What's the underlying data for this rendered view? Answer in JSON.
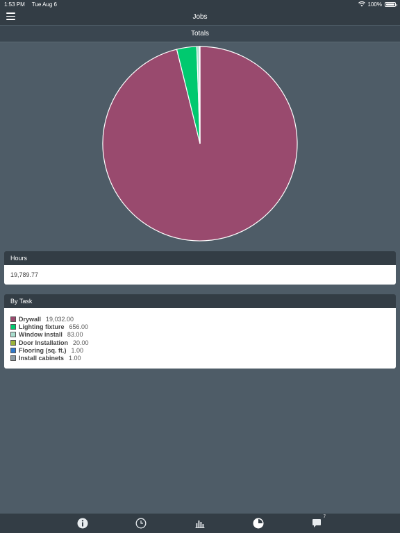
{
  "status": {
    "time": "1:53 PM",
    "date": "Tue Aug 6",
    "battery": "100%"
  },
  "nav": {
    "title": "Jobs"
  },
  "section": {
    "title": "Totals"
  },
  "hours": {
    "header": "Hours",
    "value": "19,789.77"
  },
  "by_task": {
    "header": "By Task"
  },
  "tabs": {
    "messages_badge": "7"
  },
  "colors": {
    "background": "#4e5c67",
    "bar": "#333d45"
  },
  "chart_data": {
    "type": "pie",
    "labels": [
      "Drywall",
      "Lighting fixture",
      "Window install",
      "Door Installation",
      "Flooring (sq. ft.)",
      "Install cabinets"
    ],
    "values": [
      19032.0,
      656.0,
      83.0,
      20.0,
      1.0,
      1.0
    ],
    "value_labels": [
      "19,032.00",
      "656.00",
      "83.00",
      "20.00",
      "1.00",
      "1.00"
    ],
    "colors": [
      "#994a6e",
      "#00c96f",
      "#a8dccd",
      "#9bb33a",
      "#2f78c9",
      "#8d9ba4"
    ]
  }
}
